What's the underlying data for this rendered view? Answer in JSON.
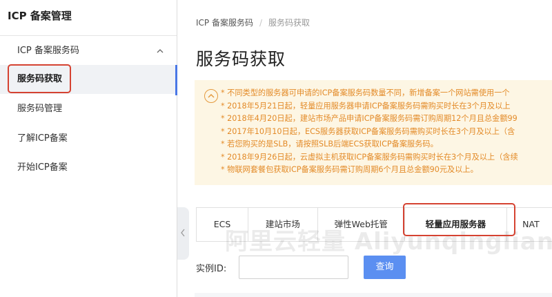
{
  "sidebar": {
    "title": "ICP 备案管理",
    "group_label": "ICP 备案服务码",
    "items": [
      {
        "label": "服务码获取"
      },
      {
        "label": "服务码管理"
      },
      {
        "label": "了解ICP备案"
      },
      {
        "label": "开始ICP备案"
      }
    ]
  },
  "breadcrumb": {
    "root": "ICP 备案服务码",
    "separator": "/",
    "current": "服务码获取"
  },
  "page": {
    "title": "服务码获取"
  },
  "notice": {
    "lines": [
      "* 不同类型的服务器可申请的ICP备案服务码数量不同，新增备案一个网站需使用一个",
      "* 2018年5月21日起，轻量应用服务器申请ICP备案服务码需购买时长在3个月及以上",
      "* 2018年4月20日起，建站市场产品申请ICP备案服务码需订购周期12个月且总金额99",
      "* 2017年10月10日起，ECS服务器获取ICP备案服务码需购买时长在3个月及以上（含",
      "* 若您购买的是SLB，请按照SLB后端ECS获取ICP备案服务码。",
      "* 2018年9月26日起，云虚拟主机获取ICP备案服务码需购买时长在3个月及以上（含续",
      "* 物联网套餐包获取ICP备案服务码需订购周期6个月且总金额90元及以上。"
    ]
  },
  "tabs": [
    {
      "label": "ECS"
    },
    {
      "label": "建站市场"
    },
    {
      "label": "弹性Web托管"
    },
    {
      "label": "轻量应用服务器"
    },
    {
      "label": "NAT"
    }
  ],
  "watermark": "阿里云轻量 Aliyunqingliang.com",
  "form": {
    "instance_label": "实例ID:",
    "instance_value": "",
    "query_label": "查询"
  },
  "colors": {
    "accent": "#5b8ff1",
    "highlight_box": "#d54231",
    "notice_text": "#e38a27",
    "notice_bg": "#fdf6e4"
  }
}
